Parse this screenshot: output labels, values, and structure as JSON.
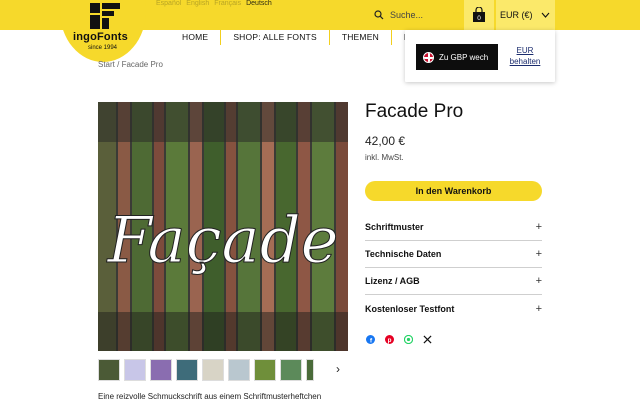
{
  "header": {
    "languages": [
      "Español",
      "English",
      "Français",
      "Deutsch"
    ],
    "active_language": "Deutsch",
    "logo_text": "ingoFonts",
    "logo_sub": "since 1994",
    "search_placeholder": "Suche...",
    "cart_count": "0",
    "currency": "EUR (€)"
  },
  "nav": {
    "items": [
      "HOME",
      "SHOP: ALLE FONTS",
      "THEMEN",
      "KO"
    ]
  },
  "breadcrumb": "Start / Facade Pro",
  "currency_popup": {
    "switch_label": "Zu GBP wech",
    "keep_label_line1": "EUR",
    "keep_label_line2": "behalten"
  },
  "product": {
    "title": "Facade Pro",
    "price": "42,00 €",
    "tax_note": "inkl. MwSt.",
    "add_to_cart": "In den Warenkorb",
    "image_word": "Façade",
    "description_start": "Eine reizvolle Schmuckschrift aus einem Schriftmusterheftchen"
  },
  "accordion": [
    {
      "label": "Schriftmuster"
    },
    {
      "label": "Technische Daten"
    },
    {
      "label": "Lizenz / AGB"
    },
    {
      "label": "Kostenloser Testfont"
    }
  ],
  "colors": {
    "brand_yellow": "#f6d92b",
    "dark": "#0d0d0d"
  },
  "icons": {
    "search": "search-icon",
    "cart": "shopping-bag-icon",
    "chevron": "chevron-down-icon",
    "share": [
      "facebook-icon",
      "pinterest-icon",
      "whatsapp-icon",
      "x-icon"
    ]
  }
}
